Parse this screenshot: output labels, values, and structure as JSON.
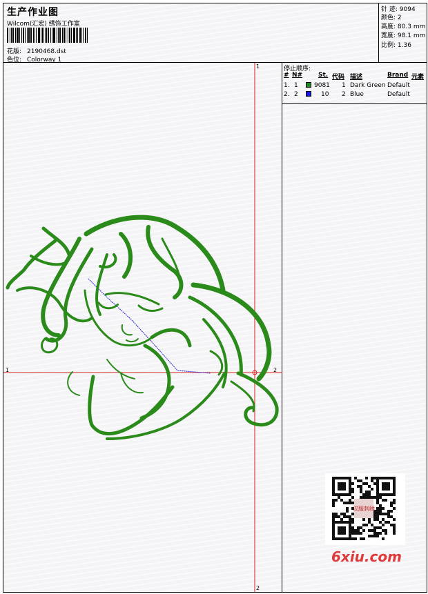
{
  "header": {
    "title": "生产作业图",
    "studio": "Wilcom(汇宏) 绣饰工作室",
    "design_label": "花版:",
    "design_value": "2190468.dst",
    "colorway_label": "色位:",
    "colorway_value": "Colorway 1"
  },
  "stats": [
    {
      "label": "针 迹:",
      "value": "9094"
    },
    {
      "label": "颜色:",
      "value": "2"
    },
    {
      "label": "高度:",
      "value": "80.3 mm"
    },
    {
      "label": "宽度:",
      "value": "98.1 mm"
    },
    {
      "label": "比例:",
      "value": "1.36"
    }
  ],
  "stop_sequence": {
    "title": "停止顺序:",
    "columns": [
      "#",
      "N#",
      "St.",
      "代码",
      "描述",
      "Brand",
      "元素"
    ],
    "rows": [
      {
        "index": "1.",
        "n": "1",
        "stitches": "9081",
        "code": "1",
        "desc": "Dark Green",
        "brand": "Default",
        "color": "#1f8a1f"
      },
      {
        "index": "2.",
        "n": "2",
        "stitches": "10",
        "code": "2",
        "desc": "Blue",
        "brand": "Default",
        "color": "#1818e0"
      }
    ]
  },
  "guides": {
    "top": "1",
    "bottom": "2",
    "left": "1",
    "right": "2"
  },
  "colors": {
    "embroidery": "#2a8a1a",
    "guide": "#d42020",
    "path": "#2020d0"
  },
  "watermark": {
    "qr_stamp": "汉服刺绣",
    "site": "6xiu.com"
  }
}
